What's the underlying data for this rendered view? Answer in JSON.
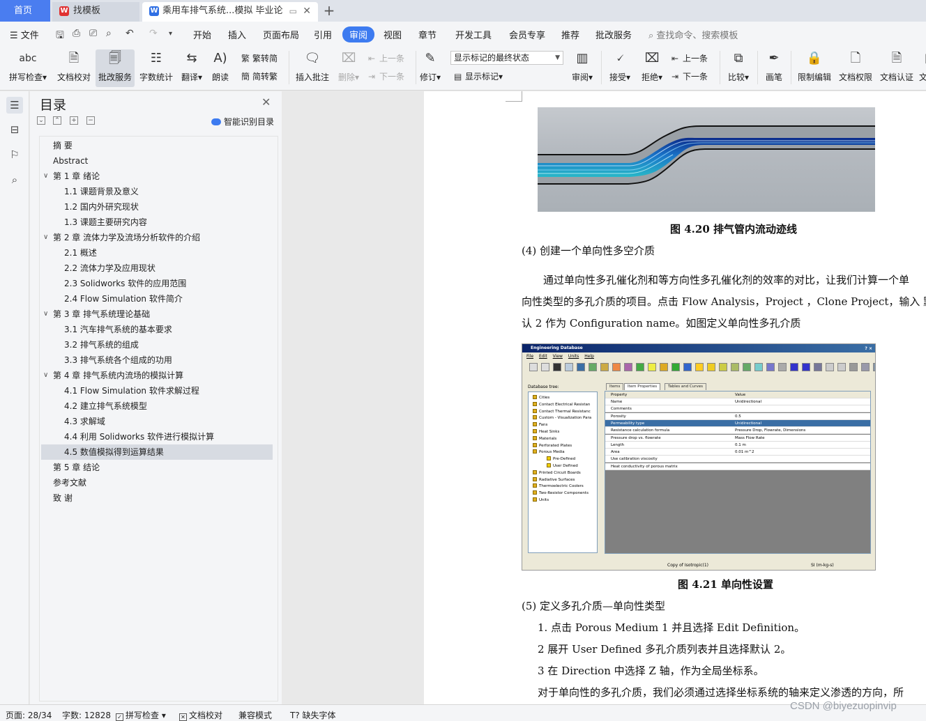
{
  "tabs": {
    "home": "首页",
    "template": "找模板",
    "document": "乘用车排气系统...模拟 毕业论文",
    "template_icon": "wps-docer-icon",
    "document_icon": "wps-writer-icon"
  },
  "menu": {
    "file": "文件",
    "items": [
      "开始",
      "插入",
      "页面布局",
      "引用",
      "审阅",
      "视图",
      "章节",
      "开发工具",
      "会员专享",
      "推荐",
      "批改服务"
    ],
    "active": "审阅",
    "search": "查找命令、搜索模板"
  },
  "ribbon": {
    "spell": "拼写检查",
    "proofread": "文档校对",
    "grading": "批改服务",
    "wordcount": "字数统计",
    "translate": "翻译",
    "read": "朗读",
    "trad": "繁转简",
    "simp": "简转繁",
    "insert_comment": "插入批注",
    "delete": "删除",
    "prev": "上一条",
    "next": "下一条",
    "revise": "修订",
    "markup_state": "显示标记的最终状态",
    "show_markup": "显示标记",
    "review": "审阅",
    "accept": "接受",
    "reject": "拒绝",
    "prev2": "上一条",
    "next2": "下一条",
    "compare": "比较",
    "pen": "画笔",
    "restrict": "限制编辑",
    "permission": "文档权限",
    "certify": "文档认证",
    "abc": "abc",
    "cut_label": "文"
  },
  "toc": {
    "title": "目录",
    "smart": "智能识别目录",
    "items": [
      {
        "level": 0,
        "text": "摘    要",
        "expand": false
      },
      {
        "level": 0,
        "text": "Abstract",
        "expand": false
      },
      {
        "level": 0,
        "text": "第 1 章  绪论",
        "expand": true
      },
      {
        "level": 1,
        "text": "1.1    课题背景及意义"
      },
      {
        "level": 1,
        "text": "1.2    国内外研究现状"
      },
      {
        "level": 1,
        "text": "1.3    课题主要研究内容"
      },
      {
        "level": 0,
        "text": "第 2 章  流体力学及流场分析软件的介绍",
        "expand": true
      },
      {
        "level": 1,
        "text": "2.1    概述"
      },
      {
        "level": 1,
        "text": "2.2    流体力学及应用现状"
      },
      {
        "level": 1,
        "text": "2.3    Solidworks 软件的应用范围"
      },
      {
        "level": 1,
        "text": "2.4    Flow Simulation  软件简介"
      },
      {
        "level": 0,
        "text": "第 3 章  排气系统理论基础",
        "expand": true
      },
      {
        "level": 1,
        "text": "3.1    汽车排气系统的基本要求"
      },
      {
        "level": 1,
        "text": "3.2    排气系统的组成"
      },
      {
        "level": 1,
        "text": "3.3    排气系统各个组成的功用"
      },
      {
        "level": 0,
        "text": "第 4 章  排气系统内流场的模拟计算",
        "expand": true
      },
      {
        "level": 1,
        "text": "4.1    Flow Simulation 软件求解过程"
      },
      {
        "level": 1,
        "text": "4.2    建立排气系统模型"
      },
      {
        "level": 1,
        "text": "4.3    求解域"
      },
      {
        "level": 1,
        "text": "4.4    利用 Solidworks 软件进行模拟计算"
      },
      {
        "level": 1,
        "text": "4.5    数值模拟得到运算结果",
        "selected": true
      },
      {
        "level": 0,
        "text": "第 5 章  结论",
        "expand": false
      },
      {
        "level": 0,
        "text": "参考文献",
        "expand": false
      },
      {
        "level": 0,
        "text": "致    谢",
        "expand": false
      }
    ]
  },
  "doc": {
    "fig1_caption": "图 4.20 排气管内流动迹线",
    "step4": "(4)  创建一个单向性多空介质",
    "para1_l1": "通过单向性多孔催化剂和等方向性多孔催化剂的效率的对比，让我们计算一个单",
    "para1_l2": "向性类型的多孔介质的项目。点击 Flow Analysis，Project ，Clone Project，输入  默",
    "para1_l3": "认 2 作为 Configuration name。如图定义单向性多孔介质",
    "fig2_caption": "图 4.21  单向性设置",
    "step5": "(5)  定义多孔介质—单向性类型",
    "li1": "1.  点击 Porous Medium 1 并且选择 Edit Definition。",
    "li2": "2    展开 User Defined 多孔介质列表并且选择默认 2。",
    "li3": "3  在 Direction 中选择 Z 轴，作为全局坐标系。",
    "para2": "对于单向性的多孔介质，我们必须通过选择坐标系统的轴来定义渗透的方向，所"
  },
  "engdb": {
    "title": "Engineering Database",
    "title_buttons": "? ×",
    "menu": [
      "File",
      "Edit",
      "View",
      "Units",
      "Help"
    ],
    "tree_label": "Database tree:",
    "tree": [
      "Cities",
      "Contact Electrical Resistan",
      "Contact Thermal Resistanc",
      "Custom - Visualization Para",
      "Fans",
      "Heat Sinks",
      "Materials",
      "Perforated Plates",
      "Porous Media"
    ],
    "tree_sub": [
      "Pre-Defined",
      "User Defined"
    ],
    "tree_after": [
      "Printed Circuit Boards",
      "Radiative Surfaces",
      "Thermoelectric Coolers",
      "Two-Resistor Components",
      "Units"
    ],
    "tabs": [
      "Items",
      "Item Properties",
      "Tables and Curves"
    ],
    "header": [
      "Property",
      "Value"
    ],
    "rows": [
      [
        "Name",
        "Unidirectional"
      ],
      [
        "Comments",
        ""
      ],
      [
        "Porosity",
        "0.5"
      ],
      [
        "Permeability type",
        "Unidirectional"
      ],
      [
        "Resistance calculation formula",
        "Pressure Drop, Flowrate, Dimensions"
      ],
      [
        "Pressure drop vs. flowrate",
        "Mass Flow Rate"
      ],
      [
        "Length",
        "0.1 m"
      ],
      [
        "Area",
        "0.01 m^2"
      ],
      [
        "Use calibration viscosity",
        ""
      ],
      [
        "Heat conductivity of porous matrix",
        ""
      ]
    ],
    "status_left": "Copy of Isotropic(1)",
    "status_right": "SI (m-kg-s)"
  },
  "status": {
    "page": "页面: 28/34",
    "words": "字数: 12828",
    "spell": "拼写检查",
    "proof": "文档校对",
    "compat": "兼容模式",
    "font": "缺失字体"
  },
  "watermark": "CSDN @biyezuopinvip",
  "colors": {
    "accent": "#3d7bf0",
    "home_tab": "#4a7df0"
  }
}
